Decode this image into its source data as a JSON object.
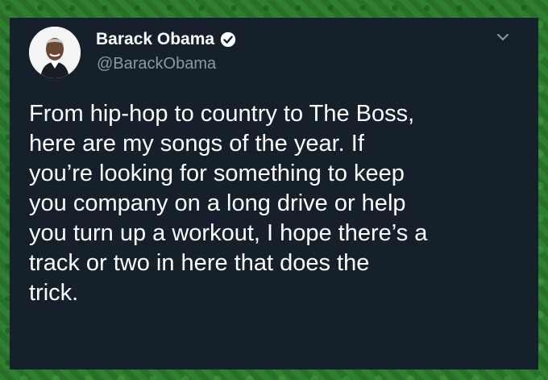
{
  "tweet": {
    "author": {
      "display_name": "Barack Obama",
      "handle": "@BarackObama",
      "verified": true,
      "avatar_icon": "profile-photo"
    },
    "text": "From hip-hop to country to The Boss,\nhere are my songs of the year. If\nyou’re looking for something to keep\nyou company on a long drive or help\nyou turn up a workout, I hope there’s a\ntrack or two in here that does the\ntrick.",
    "menu_icon": "chevron-down-icon"
  },
  "colors": {
    "card_background": "#15202b",
    "text_primary": "#ffffff",
    "text_secondary": "#8899a6",
    "frame_green": "#2f7f31"
  }
}
